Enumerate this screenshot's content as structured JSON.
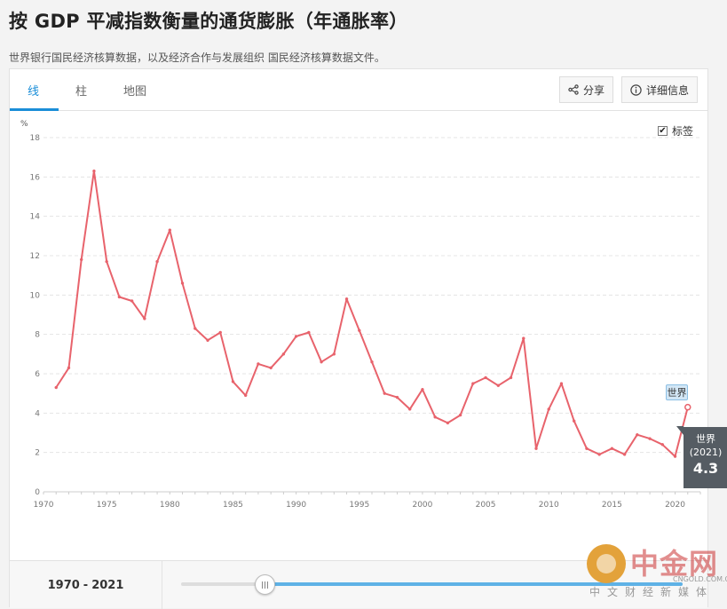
{
  "page": {
    "title": "按 GDP 平减指数衡量的通货膨胀（年通胀率）",
    "subtitle": "世界银行国民经济核算数据，以及经济合作与发展组织 国民经济核算数据文件。"
  },
  "tabs": [
    {
      "label": "线"
    },
    {
      "label": "柱"
    },
    {
      "label": "地图"
    }
  ],
  "toolbar": {
    "share_label": "分享",
    "details_label": "详细信息",
    "labels_toggle": "标签",
    "labels_checked": true
  },
  "range": {
    "start": "1970",
    "sep": "-",
    "end": "2021"
  },
  "tooltip": {
    "series": "世界",
    "year": "(2021)",
    "value": "4.3"
  },
  "point_label": "世界",
  "watermark": {
    "name": "中金网",
    "site": "CNGOLD.COM.CN",
    "slogan": "中文财经新媒体"
  },
  "colors": {
    "line": "#e8636c",
    "accent": "#1a8ed8",
    "tooltip_bg": "#555c63"
  },
  "chart_data": {
    "type": "line",
    "ylabel": "%",
    "ylim": [
      0,
      18
    ],
    "yticks": [
      0,
      2,
      4,
      6,
      8,
      10,
      12,
      14,
      16,
      18
    ],
    "xlim": [
      1970,
      2022
    ],
    "xticks": [
      1970,
      1975,
      1980,
      1985,
      1990,
      1995,
      2000,
      2005,
      2010,
      2015,
      2020
    ],
    "grid": true,
    "series": [
      {
        "name": "世界",
        "x": [
          1971,
          1972,
          1973,
          1974,
          1975,
          1976,
          1977,
          1978,
          1979,
          1980,
          1981,
          1982,
          1983,
          1984,
          1985,
          1986,
          1987,
          1988,
          1989,
          1990,
          1991,
          1992,
          1993,
          1994,
          1995,
          1996,
          1997,
          1998,
          1999,
          2000,
          2001,
          2002,
          2003,
          2004,
          2005,
          2006,
          2007,
          2008,
          2009,
          2010,
          2011,
          2012,
          2013,
          2014,
          2015,
          2016,
          2017,
          2018,
          2019,
          2020,
          2021
        ],
        "values": [
          5.3,
          6.3,
          11.8,
          16.3,
          11.7,
          9.9,
          9.7,
          8.8,
          11.7,
          13.3,
          10.6,
          8.3,
          7.7,
          8.1,
          5.6,
          4.9,
          6.5,
          6.3,
          7.0,
          7.9,
          8.1,
          6.6,
          7.0,
          9.8,
          8.2,
          6.6,
          5.0,
          4.8,
          4.2,
          5.2,
          3.8,
          3.5,
          3.9,
          5.5,
          5.8,
          5.4,
          5.8,
          7.8,
          2.2,
          4.2,
          5.5,
          3.6,
          2.2,
          1.9,
          2.2,
          1.9,
          2.9,
          2.7,
          2.4,
          1.8,
          4.3
        ]
      }
    ]
  }
}
